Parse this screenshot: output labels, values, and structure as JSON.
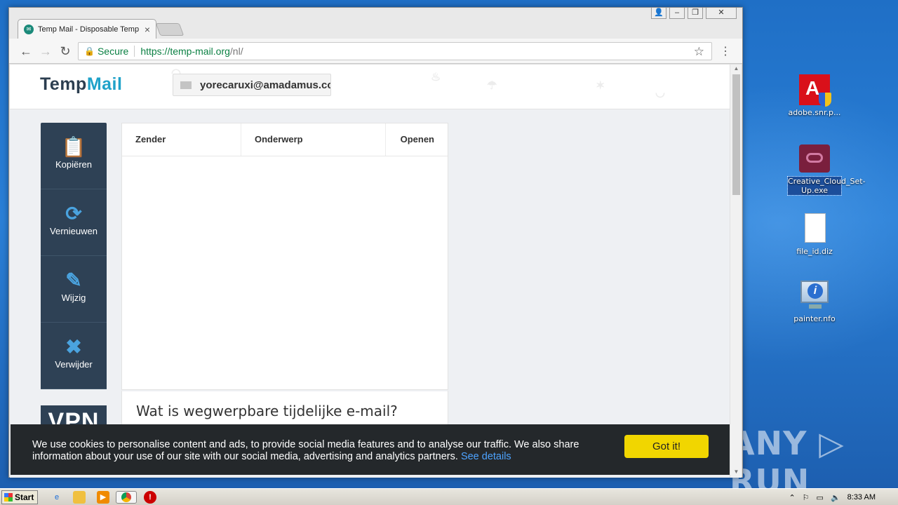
{
  "desktop": {
    "icons": [
      {
        "label": "adobe.snr.p...",
        "icon": "adobe-installer-icon"
      },
      {
        "label": "Creative_Cloud_Set-Up.exe",
        "icon": "creative-cloud-icon"
      },
      {
        "label": "file_id.diz",
        "icon": "document-icon"
      },
      {
        "label": "painter.nfo",
        "icon": "info-file-icon"
      }
    ],
    "watermark": "ANY ▷ RUN"
  },
  "browser": {
    "tab_title": "Temp Mail - Disposable Temp",
    "address": {
      "secure_label": "Secure",
      "url_host": "https://temp-mail.org",
      "url_path": "/nl/"
    }
  },
  "site": {
    "logo_part1": "Temp",
    "logo_part2": "Mail",
    "email": "yorecaruxi@amadamus.cc",
    "sidebar": [
      {
        "label": "Kopiëren",
        "icon": "clipboard-icon"
      },
      {
        "label": "Vernieuwen",
        "icon": "refresh-icon"
      },
      {
        "label": "Wijzig",
        "icon": "edit-icon"
      },
      {
        "label": "Verwijder",
        "icon": "delete-icon"
      }
    ],
    "vpn_label": "VPN",
    "inbox_columns": [
      "Zender",
      "Onderwerp",
      "Openen"
    ],
    "info_heading": "Wat is wegwerpbare tijdelijke e-mail?"
  },
  "cookie_banner": {
    "message": "We use cookies to personalise content and ads, to provide social media features and to analyse our traffic. We also share information about your use of our site with our social media, advertising and analytics partners.",
    "link": "See details",
    "button": "Got it!"
  },
  "taskbar": {
    "start_label": "Start",
    "clock": "8:33 AM"
  }
}
